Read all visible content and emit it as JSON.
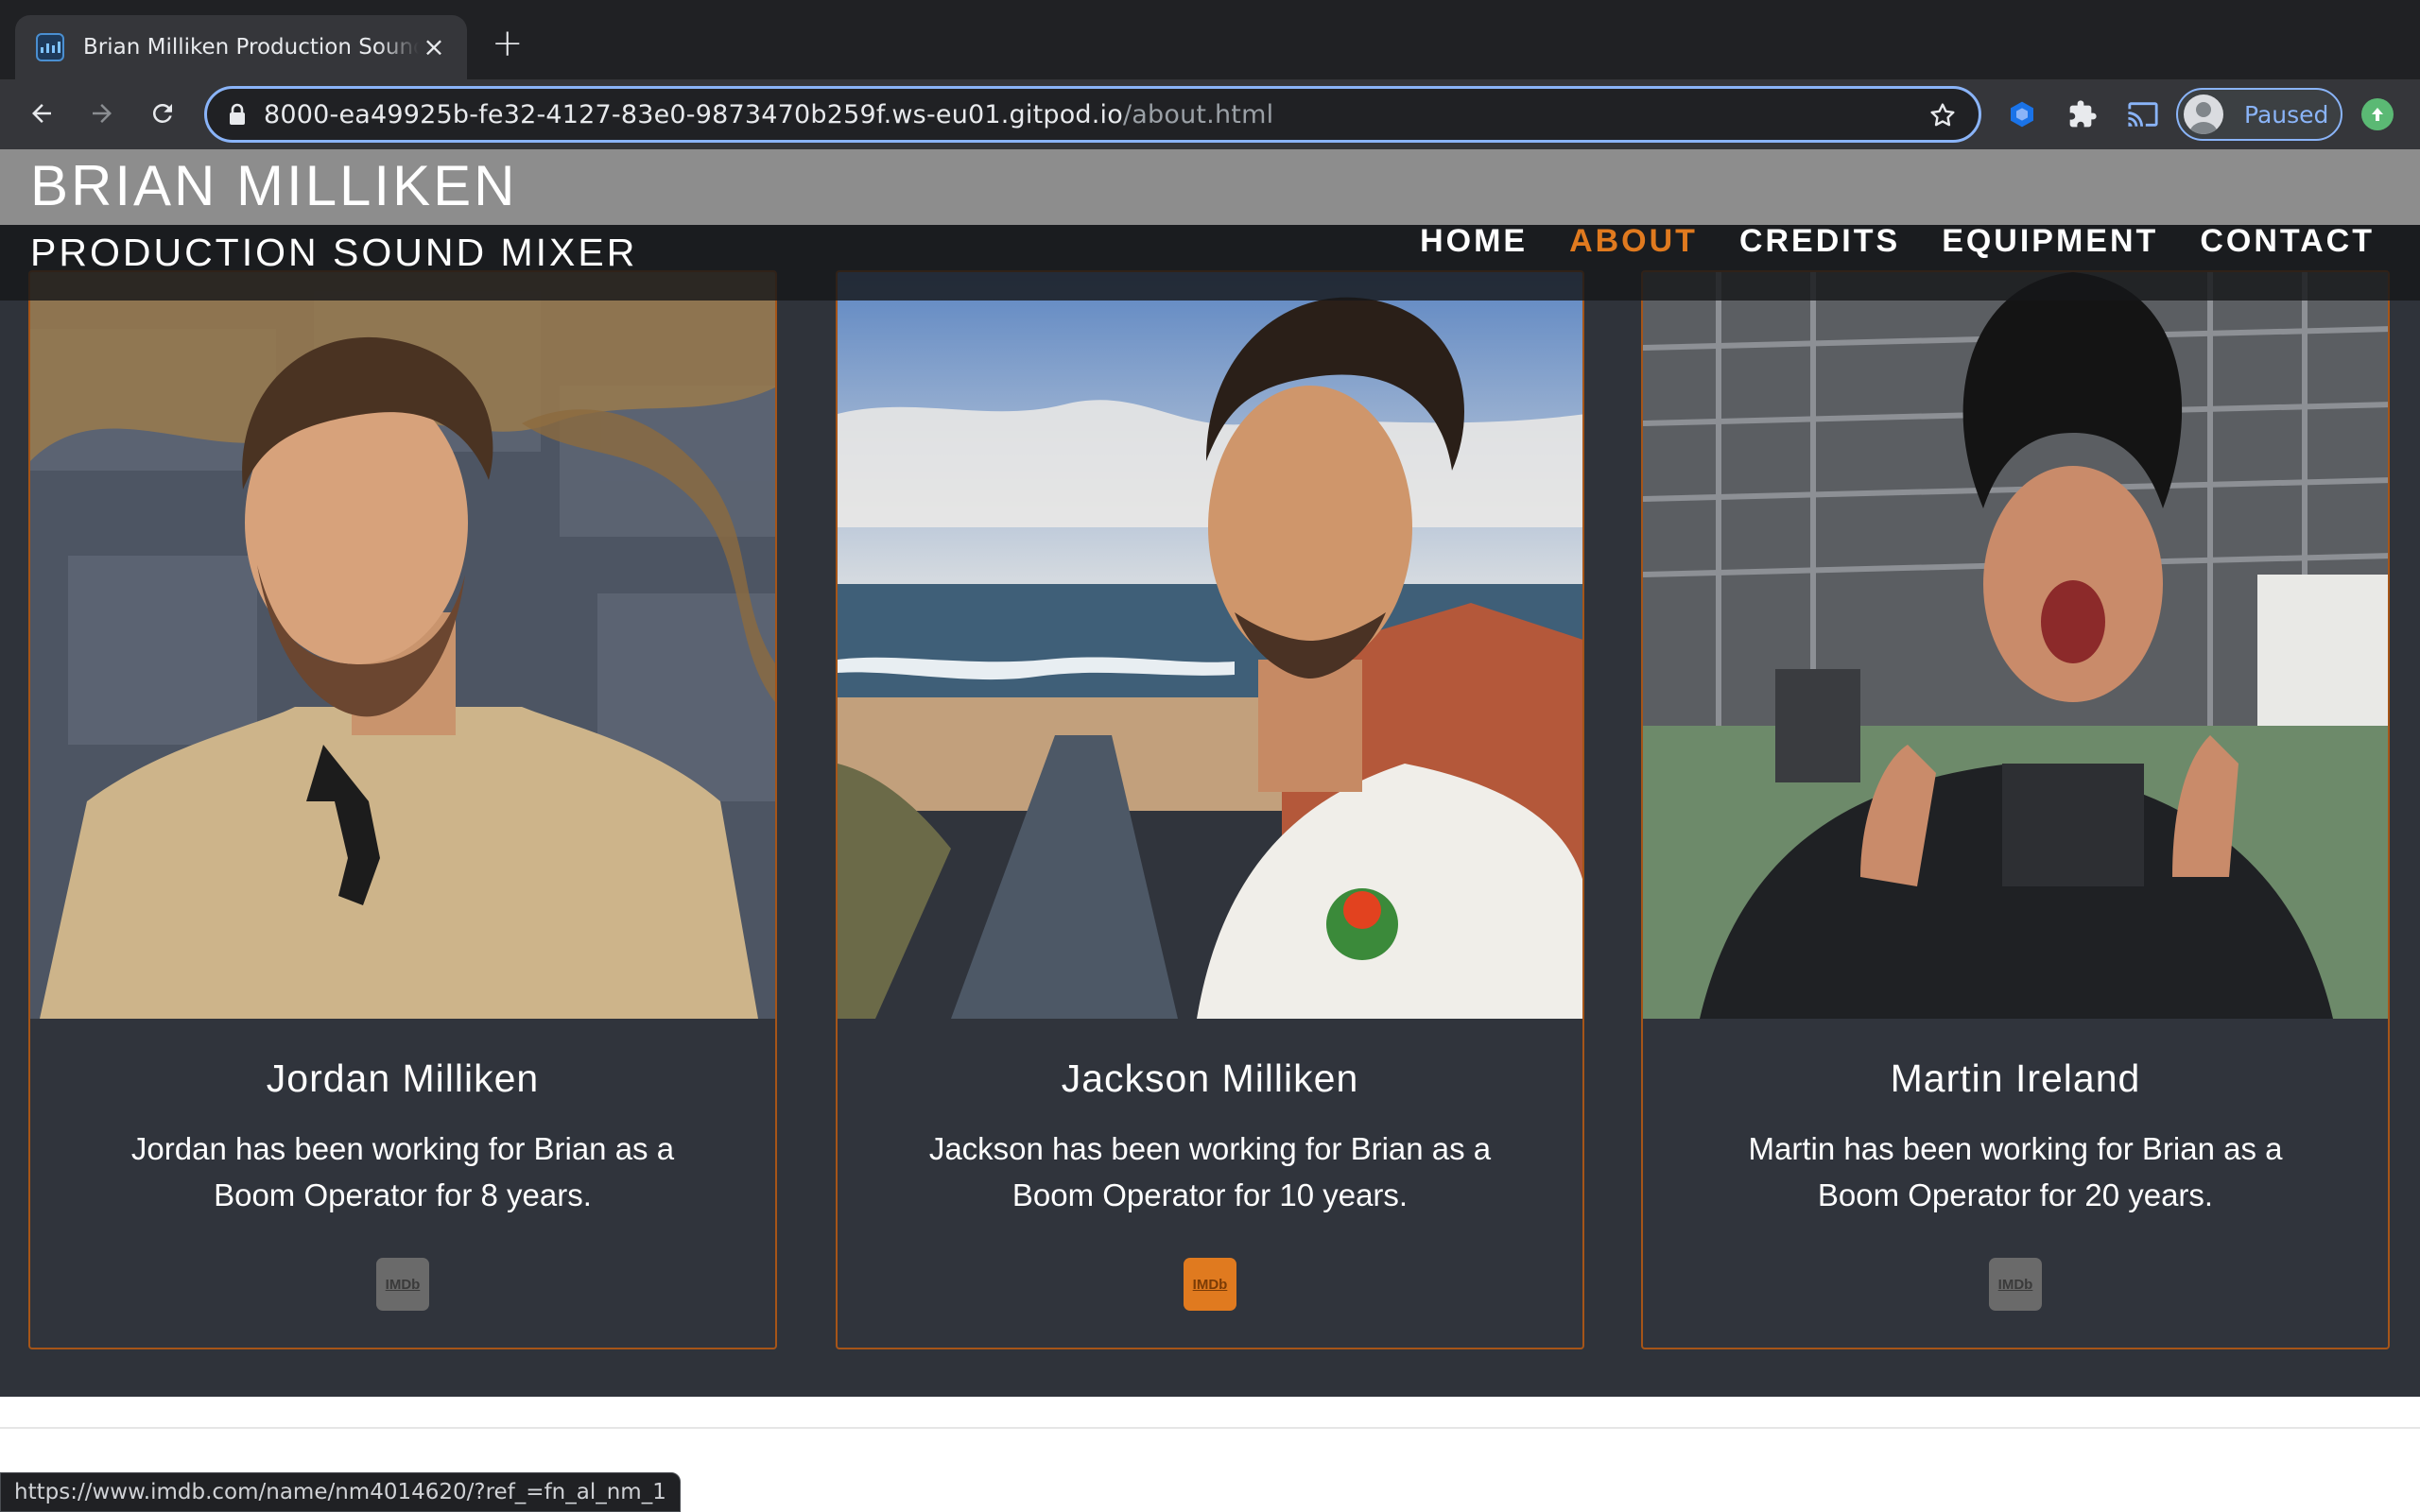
{
  "browser": {
    "tab_title": "Brian Milliken Production Sound Mixer",
    "url_host": "8000-ea49925b-fe32-4127-83e0-9873470b259f.ws-eu01.gitpod.io",
    "url_path": "/about.html",
    "profile_status": "Paused",
    "status_url": "https://www.imdb.com/name/nm4014620/?ref_=fn_al_nm_1"
  },
  "site": {
    "brand": "BRIAN MILLIKEN",
    "tagline": "PRODUCTION SOUND MIXER",
    "nav": [
      "HOME",
      "ABOUT",
      "CREDITS",
      "EQUIPMENT",
      "CONTACT"
    ],
    "active_nav": "ABOUT"
  },
  "team": [
    {
      "name": "Jordan Milliken",
      "bio": "Jordan has been working for Brian as a Boom Operator for 8 years.",
      "link_label": "IMDb"
    },
    {
      "name": "Jackson Milliken",
      "bio": "Jackson has been working for Brian as a Boom Operator for 10 years.",
      "link_label": "IMDb"
    },
    {
      "name": "Martin Ireland",
      "bio": "Martin has been working for Brian as a Boom Operator for 20 years.",
      "link_label": "IMDb"
    }
  ],
  "colors": {
    "accent": "#e07a1f",
    "page_bg": "#2f333a",
    "card_border": "#a65518"
  }
}
